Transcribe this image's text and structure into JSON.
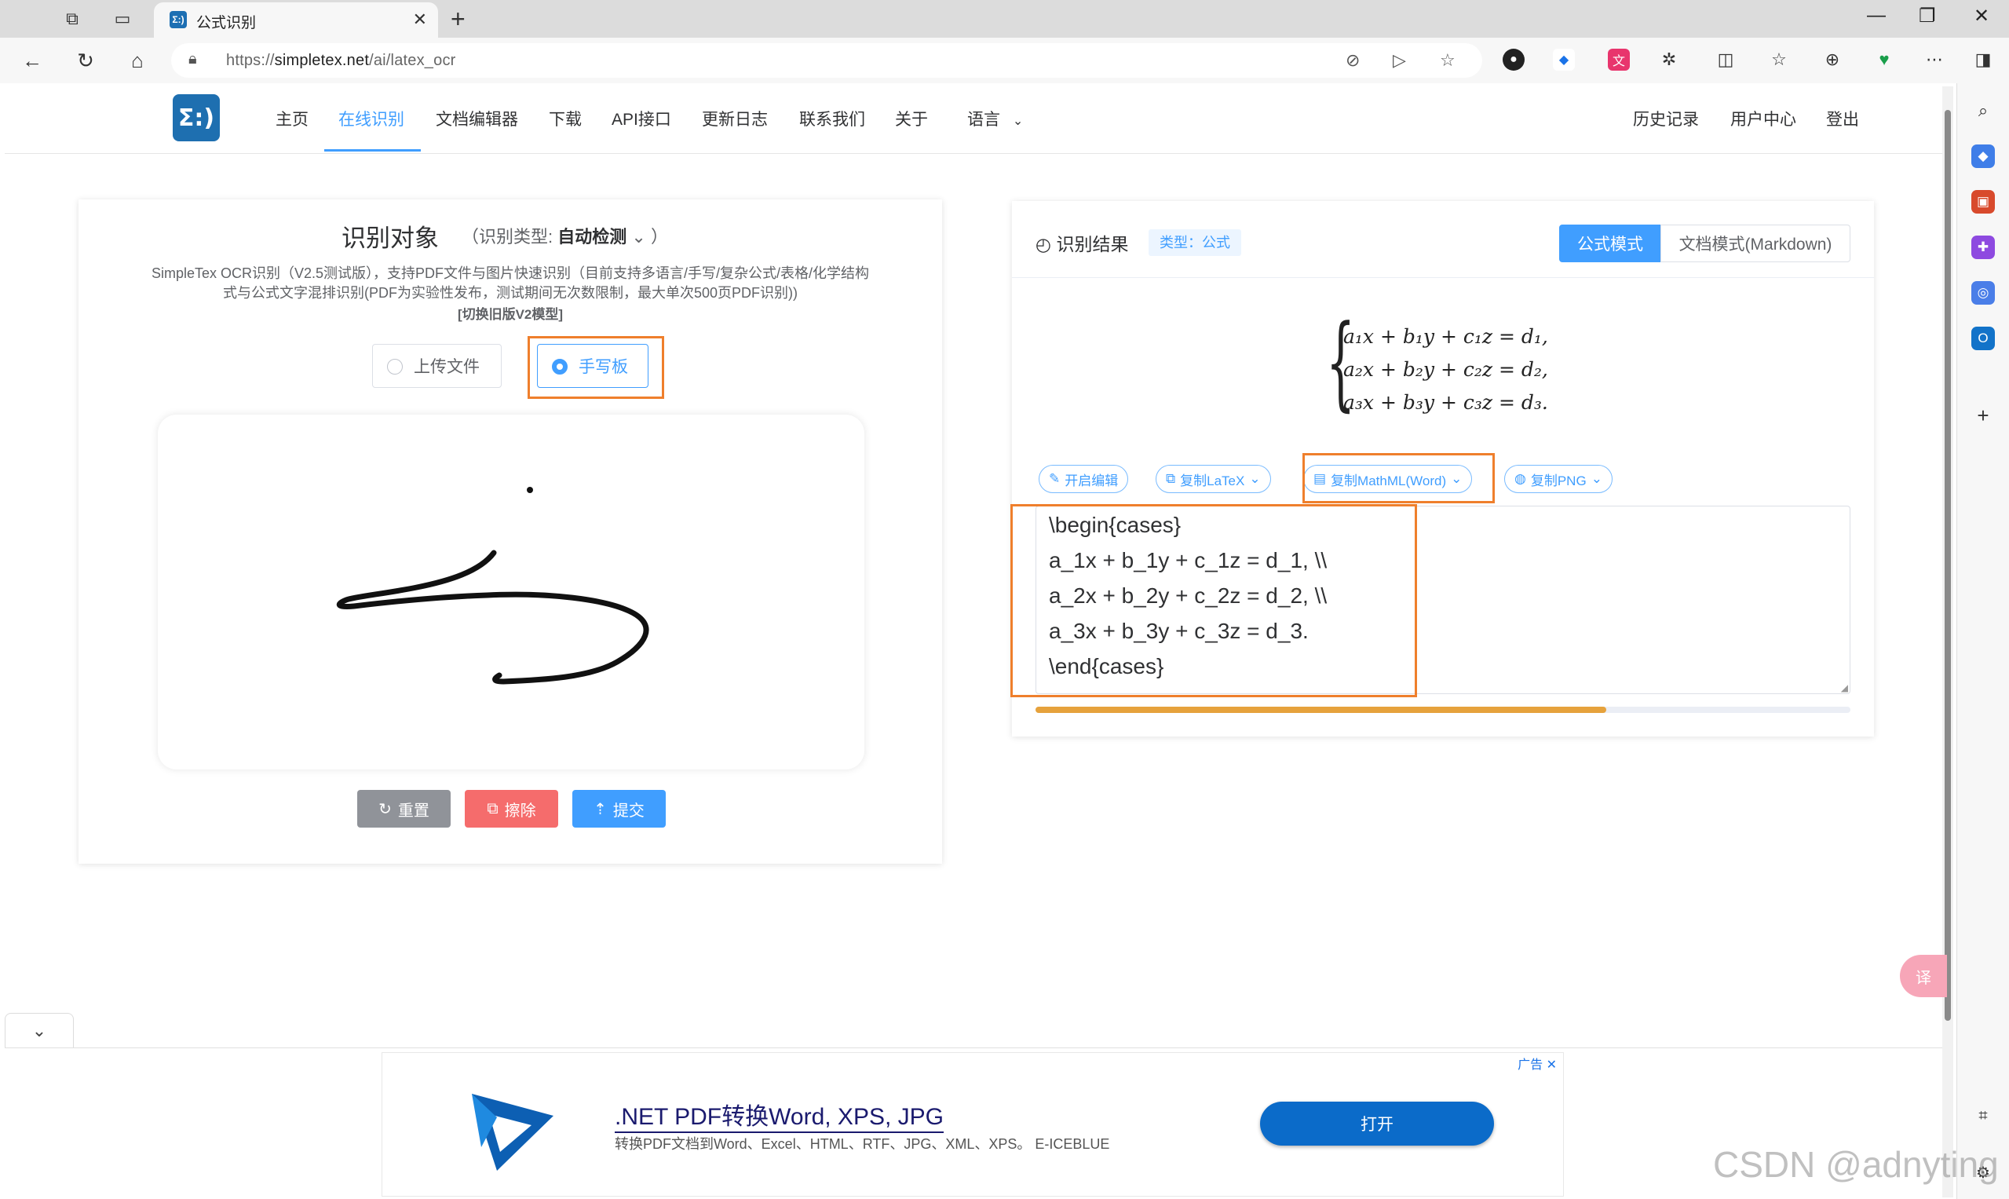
{
  "browser": {
    "tab_title": "公式识别",
    "tab_favicon": "Σ:)",
    "url_prefix": "https://",
    "url_host": "simpletex.net",
    "url_path": "/ai/latex_ocr",
    "new_tab": "+",
    "minimize": "—",
    "restore": "❐",
    "close": "✕"
  },
  "site": {
    "logo_text": "Σ:)",
    "menu": [
      "主页",
      "在线识别",
      "文档编辑器",
      "下载",
      "API接口",
      "更新日志",
      "联系我们",
      "关于",
      "语言"
    ],
    "active_menu": "在线识别",
    "right_menu": [
      "历史记录",
      "用户中心",
      "登出"
    ]
  },
  "left_panel": {
    "title": "识别对象",
    "type_label": "（识别类型:",
    "type_value": "自动检测",
    "type_suffix": "）",
    "desc": "SimpleTex OCR识别（V2.5测试版），支持PDF文件与图片快速识别（目前支持多语言/手写/复杂公式/表格/化学结构式与公式文字混排识别(PDF为实验性发布，测试期间无次数限制，最大单次500页PDF识别))",
    "switch_link": "[切换旧版V2模型]",
    "options": [
      "上传文件",
      "手写板"
    ],
    "selected_option": "手写板",
    "buttons": {
      "reset": "重置",
      "erase": "擦除",
      "submit": "提交"
    }
  },
  "right_panel": {
    "title": "识别结果",
    "tag": "类型：公式",
    "modes": [
      "公式模式",
      "文档模式(Markdown)"
    ],
    "active_mode": "公式模式",
    "rendered_formula": [
      "a₁x + b₁y + c₁z = d₁,",
      "a₂x + b₂y + c₂z = d₂,",
      "a₃x + b₃y + c₃z = d₃."
    ],
    "actions": [
      "开启编辑",
      "复制LaTeX",
      "复制MathML(Word)",
      "复制PNG"
    ],
    "latex_lines": [
      "\\begin{cases}",
      "a_1x + b_1y + c_1z = d_1, \\\\",
      "a_2x + b_2y + c_2z = d_2, \\\\",
      "a_3x + b_3y + c_3z = d_3.",
      "\\end{cases}"
    ],
    "progress": 0.7
  },
  "ad": {
    "label": "广告 ✕",
    "title": ".NET PDF转换Word, XPS, JPG",
    "subtitle": "转换PDF文档到Word、Excel、HTML、RTF、JPG、XML、XPS。 E-ICEBLUE",
    "button": "打开"
  },
  "watermark": "CSDN @adnyting",
  "translate_float": "译",
  "colors": {
    "accent": "#409eff",
    "highlight": "#ef7f2c",
    "erase": "#f56c6c",
    "reset": "#909399",
    "progress": "#e6a23c"
  }
}
